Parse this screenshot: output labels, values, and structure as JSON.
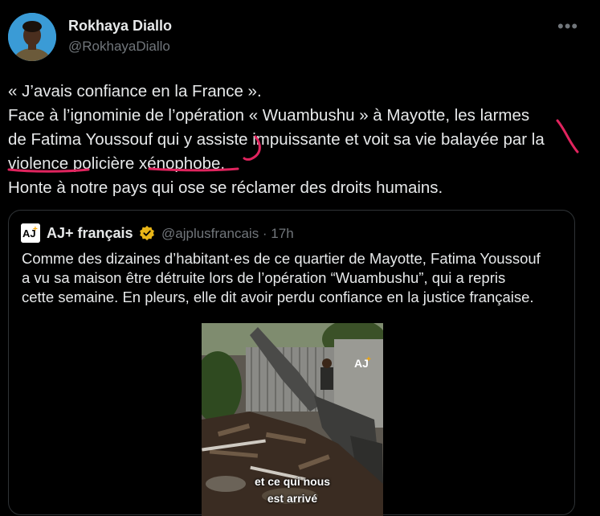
{
  "author": {
    "name": "Rokhaya Diallo",
    "handle": "@RokhayaDiallo"
  },
  "tweet": {
    "lines": [
      "« J’avais confiance en la France ».",
      "Face à l’ignominie de l’opération « Wuambushu » à Mayotte, les larmes",
      "de Fatima Youssouf qui y assiste impuissante et voit sa vie balayée par la",
      "violence policière xénophobe.",
      "Honte à notre pays qui ose se réclamer des droits humains."
    ]
  },
  "quoted": {
    "name": "AJ+ français",
    "handle_time": "@ajplusfrancais · 17h",
    "lines": [
      "Comme des dizaines d’habitant·es de ce quartier de Mayotte, Fatima Youssouf",
      "a vu sa maison être détruite lors de l’opération “Wuambushu”, qui a repris",
      "cette semaine. En pleurs, elle dit avoir perdu confiance en la justice française."
    ],
    "video_caption_1": "et ce qui nous",
    "video_caption_2": "est arrivé",
    "logo_text": "AJ+"
  },
  "colors": {
    "background": "#000000",
    "text": "#e7e9ea",
    "secondary": "#71767b",
    "border": "#2f3336",
    "annotation": "#e0245e",
    "verified": "#e8b517"
  },
  "icons": [
    "more-icon",
    "verified-badge-icon",
    "aj-logo-icon"
  ]
}
